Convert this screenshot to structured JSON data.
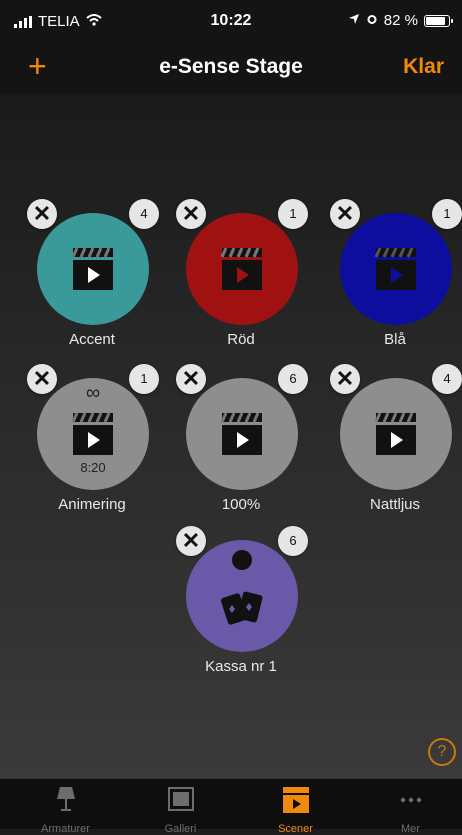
{
  "status_bar": {
    "carrier": "TELIA",
    "time": "10:22",
    "battery": "82 %"
  },
  "nav": {
    "add_label": "+",
    "title": "e-Sense Stage",
    "done_label": "Klar"
  },
  "scenes": [
    {
      "name": "Accent",
      "count": "4",
      "color": "#3a9a99",
      "icon": "clapperboard-icon"
    },
    {
      "name": "Röd",
      "count": "1",
      "color": "#a01212",
      "icon": "clapperboard-icon"
    },
    {
      "name": "Blå",
      "count": "1",
      "color": "#0d0d9e",
      "icon": "clapperboard-icon"
    },
    {
      "name": "Animering",
      "count": "1",
      "color": "#8e8e8e",
      "icon": "clapperboard-icon",
      "loop": "∞",
      "duration": "8:20"
    },
    {
      "name": "100%",
      "count": "6",
      "color": "#8e8e8e",
      "icon": "clapperboard-icon"
    },
    {
      "name": "Nattljus",
      "count": "4",
      "color": "#8e8e8e",
      "icon": "clapperboard-icon"
    },
    {
      "name": "Kassa nr 1",
      "count": "6",
      "color": "#6a58a8",
      "icon": "cards-icon"
    }
  ],
  "close_symbol": "✕",
  "help_label": "?",
  "tabs": [
    {
      "label": "Armaturer",
      "icon": "lamp-icon",
      "active": false
    },
    {
      "label": "Galleri",
      "icon": "gallery-icon",
      "active": false
    },
    {
      "label": "Scener",
      "icon": "scenes-icon",
      "active": true
    },
    {
      "label": "Mer",
      "icon": "more-icon",
      "active": false
    }
  ],
  "colors": {
    "accent": "#f08a0e",
    "badge": "#e6e6e6"
  }
}
